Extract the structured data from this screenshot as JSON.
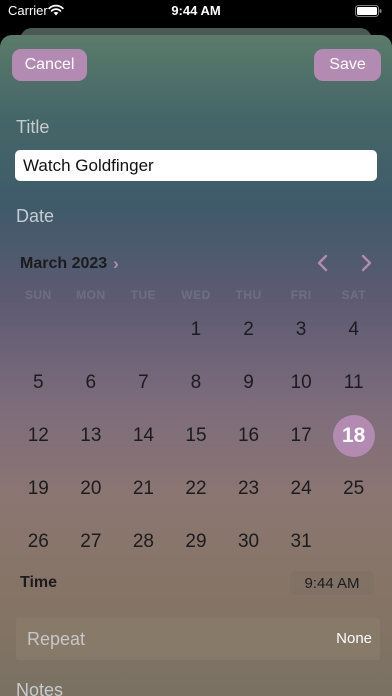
{
  "status_bar": {
    "carrier": "Carrier",
    "time": "9:44 AM"
  },
  "header": {
    "cancel_label": "Cancel",
    "save_label": "Save"
  },
  "form": {
    "title_label": "Title",
    "title_value": "Watch Goldfinger",
    "date_label": "Date",
    "notes_label": "Notes"
  },
  "calendar": {
    "month_label": "March 2023",
    "weekdays": [
      "SUN",
      "MON",
      "TUE",
      "WED",
      "THU",
      "FRI",
      "SAT"
    ],
    "days": [
      [
        "",
        "",
        "",
        "1",
        "2",
        "3",
        "4"
      ],
      [
        "5",
        "6",
        "7",
        "8",
        "9",
        "10",
        "11"
      ],
      [
        "12",
        "13",
        "14",
        "15",
        "16",
        "17",
        "18"
      ],
      [
        "19",
        "20",
        "21",
        "22",
        "23",
        "24",
        "25"
      ],
      [
        "26",
        "27",
        "28",
        "29",
        "30",
        "31",
        ""
      ]
    ],
    "selected_day": "18"
  },
  "time": {
    "label": "Time",
    "value": "9:44 AM"
  },
  "repeat": {
    "label": "Repeat",
    "value": "None"
  },
  "colors": {
    "accent": "#b38bb2"
  }
}
